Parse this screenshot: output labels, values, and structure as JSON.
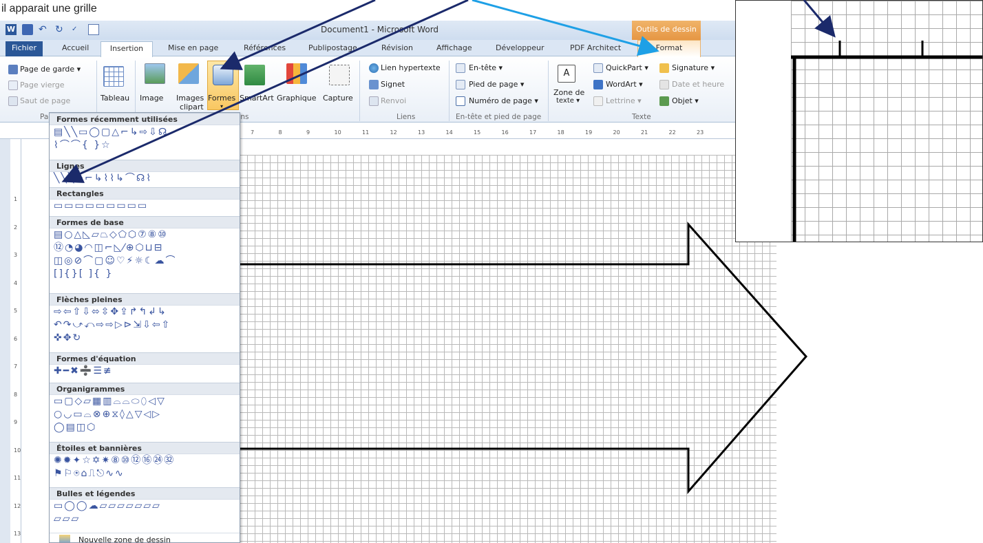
{
  "intro_text": "il apparait une grille",
  "window": {
    "title": "Document1  -  Microsoft Word",
    "context_header": "Outils de dessin"
  },
  "tabs": {
    "file": "Fichier",
    "home": "Accueil",
    "insert": "Insertion",
    "layout": "Mise en page",
    "references": "Références",
    "mailings": "Publipostage",
    "review": "Révision",
    "view": "Affichage",
    "developer": "Développeur",
    "pdf": "PDF Architect",
    "format": "Format"
  },
  "ribbon": {
    "pages": {
      "cover": "Page de garde ▾",
      "blank": "Page vierge",
      "break": "Saut de page",
      "label": "Pages"
    },
    "tables": {
      "table": "Tableau"
    },
    "illustrations": {
      "image": "Image",
      "clipart1": "Images",
      "clipart2": "clipart",
      "shapes": "Formes",
      "smartart": "SmartArt",
      "chart": "Graphique",
      "capture": "Capture",
      "label": "Illustrations"
    },
    "links": {
      "hyperlink": "Lien hypertexte",
      "bookmark": "Signet",
      "crossref": "Renvoi",
      "label": "Liens"
    },
    "header_footer": {
      "header": "En-tête ▾",
      "footer": "Pied de page ▾",
      "page_number": "Numéro de page ▾",
      "label": "En-tête et pied de page"
    },
    "text": {
      "textbox1": "Zone de",
      "textbox2": "texte ▾",
      "quickpart": "QuickPart ▾",
      "wordart": "WordArt ▾",
      "dropcap": "Lettrine ▾",
      "signature": "Signature ▾",
      "datetime": "Date et heure",
      "object": "Objet ▾",
      "label": "Texte"
    }
  },
  "ruler": {
    "top_numbers": [
      "7",
      "8",
      "9",
      "10",
      "11",
      "12",
      "13",
      "14",
      "15",
      "16",
      "17",
      "18",
      "19",
      "20",
      "21",
      "22",
      "23"
    ],
    "left_numbers": [
      "1",
      "2",
      "3",
      "4",
      "5",
      "6",
      "7",
      "8",
      "9",
      "10",
      "11",
      "12",
      "13"
    ]
  },
  "shapes_menu": {
    "recent": "Formes récemment utilisées",
    "lines": "Lignes",
    "rectangles": "Rectangles",
    "basic": "Formes de base",
    "block_arrows": "Flèches pleines",
    "equation": "Formes d'équation",
    "flowchart": "Organigrammes",
    "stars": "Étoiles et bannières",
    "callouts": "Bulles et légendes",
    "new_canvas": "Nouvelle zone de dessin"
  },
  "colors": {
    "arrow_dark": "#1b2a6b",
    "arrow_light": "#1ea0e6",
    "file_tab": "#2b5797",
    "context": "#e59441"
  }
}
